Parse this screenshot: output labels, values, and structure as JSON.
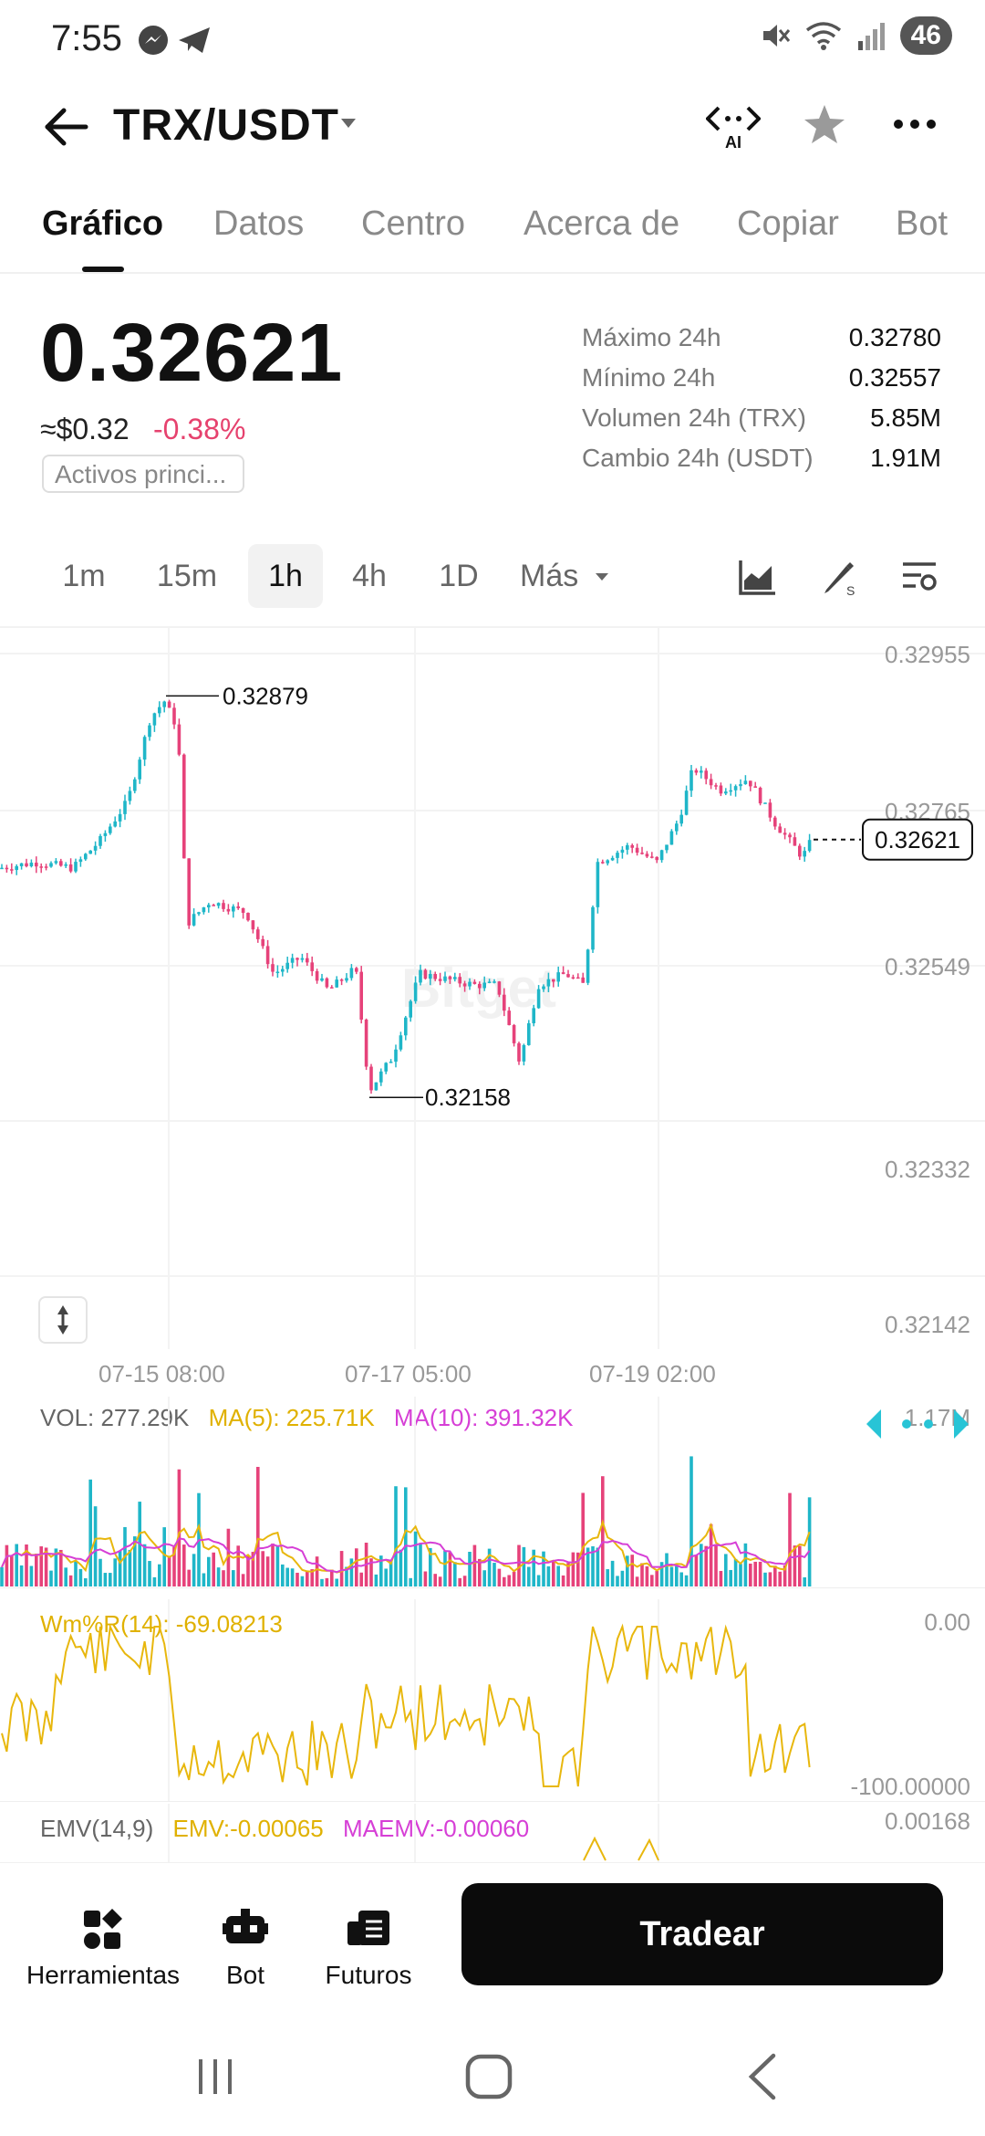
{
  "status_bar": {
    "time": "7:55",
    "battery": "46"
  },
  "header": {
    "pair": "TRX/USDT",
    "ai_label": "AI"
  },
  "tabs": [
    {
      "label": "Gráfico",
      "active": true
    },
    {
      "label": "Datos"
    },
    {
      "label": "Centro"
    },
    {
      "label": "Acerca de"
    },
    {
      "label": "Copiar"
    },
    {
      "label": "Bot"
    }
  ],
  "ticker": {
    "price": "0.32621",
    "usd_price": "≈$0.32",
    "change": "-0.38%",
    "tag": "Activos princi...",
    "stats": [
      {
        "label": "Máximo 24h",
        "value": "0.32780"
      },
      {
        "label": "Mínimo 24h",
        "value": "0.32557"
      },
      {
        "label": "Volumen 24h (TRX)",
        "value": "5.85M"
      },
      {
        "label": "Cambio 24h (USDT)",
        "value": "1.91M"
      }
    ]
  },
  "intervals": [
    {
      "label": "1m"
    },
    {
      "label": "15m"
    },
    {
      "label": "1h",
      "active": true
    },
    {
      "label": "4h"
    },
    {
      "label": "1D"
    },
    {
      "label": "Más"
    }
  ],
  "chart_data": {
    "type": "candlestick",
    "price_axis_ticks": [
      "0.32955",
      "0.32765",
      "0.32549",
      "0.32332",
      "0.32142"
    ],
    "current_price_label": "0.32621",
    "high_marker": "0.32879",
    "low_marker": "0.32158",
    "x_ticks": [
      "07-15 08:00",
      "07-17 05:00",
      "07-19 02:00"
    ],
    "watermark": "Bitget",
    "colors": {
      "up": "#1fb6c8",
      "down": "#e6427a",
      "ma5": "#e8b70d",
      "ma10": "#d63fd6",
      "wr": "#e8b70d"
    }
  },
  "indicators": {
    "vol": {
      "label": "VOL: 277.29K",
      "ma5": "MA(5): 225.71K",
      "ma10": "MA(10): 391.32K",
      "axis_max": "1.17M"
    },
    "wr": {
      "label": "Wm%R(14): -69.08213",
      "axis_top": "0.00",
      "axis_bottom": "-100.00000"
    },
    "emv": {
      "label": "EMV(14,9)",
      "emv": "EMV:-0.00065",
      "maemv": "MAEMV:-0.00060",
      "axis_top": "0.00168"
    }
  },
  "bottom_bar": {
    "tools_label": "Herramientas",
    "bot_label": "Bot",
    "futures_label": "Futuros",
    "trade_label": "Tradear"
  }
}
